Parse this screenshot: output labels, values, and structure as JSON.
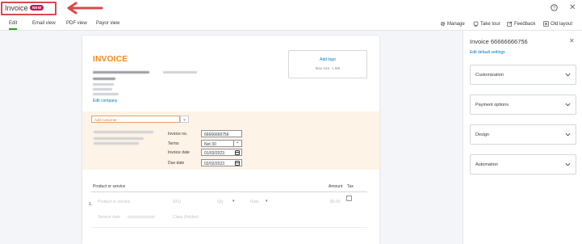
{
  "header": {
    "title": "Invoice",
    "badge": "NEW"
  },
  "tabs": [
    {
      "label": "Edit",
      "active": true
    },
    {
      "label": "Email view"
    },
    {
      "label": "PDF view"
    },
    {
      "label": "Payor view"
    }
  ],
  "toolbar": {
    "manage": "Manage",
    "take_tour": "Take tour",
    "feedback": "Feedback",
    "old_layout": "Old layout"
  },
  "invoice": {
    "title": "INVOICE",
    "edit_company": "Edit company",
    "logo": {
      "add_label": "Add logo",
      "max_size": "Max size: 1 MB"
    },
    "customer_placeholder": "Add customer",
    "fields": {
      "invoice_no_label": "Invoice no.",
      "invoice_no_value": "66666666756",
      "terms_label": "Terms",
      "terms_value": "Net 30",
      "invoice_date_label": "Invoice date",
      "invoice_date_value": "01/03/2023",
      "due_date_label": "Due date",
      "due_date_value": "02/02/2023"
    },
    "lines": {
      "header_product": "Product or service",
      "header_amount": "Amount",
      "header_tax": "Tax",
      "row_number": "1.",
      "row_product": "Product or service",
      "row_sku": "SKU",
      "row_qty": "Qty",
      "row_rate": "Rate",
      "row_amount": "$0.00",
      "service_date": "Service date",
      "class_hidden": "Class (hidden)"
    }
  },
  "panel": {
    "title": "Invoice 66666666756",
    "edit_defaults": "Edit default settings",
    "sections": [
      "Customization",
      "Payment options",
      "Design",
      "Automation"
    ]
  },
  "colors": {
    "accent_green": "#2ca01c",
    "invoice_orange": "#f08a1b",
    "link_blue": "#0077c5",
    "badge_magenta": "#c2185b",
    "highlight_red": "#d54b4b"
  }
}
